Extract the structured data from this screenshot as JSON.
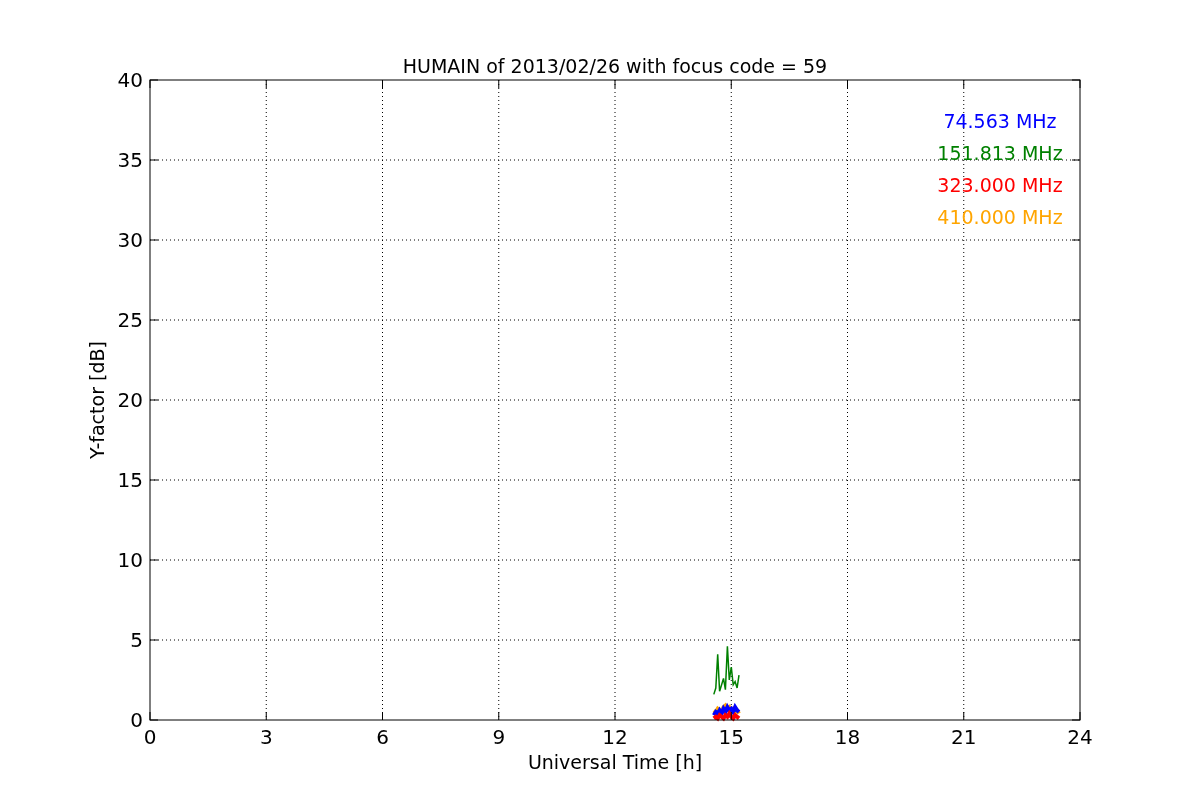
{
  "chart_data": {
    "type": "line",
    "title": "HUMAIN of 2013/02/26 with focus code = 59",
    "xlabel": "Universal Time [h]",
    "ylabel": "Y-factor [dB]",
    "x": [
      14.55,
      14.6,
      14.65,
      14.7,
      14.75,
      14.8,
      14.85,
      14.9,
      14.95,
      15.0,
      15.05,
      15.1,
      15.15,
      15.2
    ],
    "series": [
      {
        "name": "74.563 MHz",
        "color": "#0000ff",
        "values": [
          0.3,
          0.5,
          0.4,
          0.6,
          0.4,
          0.7,
          0.5,
          0.8,
          0.6,
          0.7,
          0.5,
          0.8,
          0.6,
          0.5
        ]
      },
      {
        "name": "151.813 MHz",
        "color": "#008000",
        "values": [
          1.6,
          2.0,
          4.1,
          1.8,
          2.2,
          2.6,
          1.9,
          4.6,
          2.5,
          3.3,
          2.2,
          2.4,
          2.0,
          2.8
        ]
      },
      {
        "name": "323.000 MHz",
        "color": "#ff0000",
        "values": [
          0.1,
          0.2,
          0.1,
          0.3,
          0.2,
          0.1,
          0.3,
          0.2,
          0.4,
          0.2,
          0.1,
          0.3,
          0.2,
          0.1
        ]
      },
      {
        "name": "410.000 MHz",
        "color": "#ffa500",
        "values": [
          0.6,
          0.5,
          0.7,
          0.6,
          0.5,
          0.8,
          0.9,
          0.7,
          0.8,
          0.6,
          0.7,
          0.5,
          0.6,
          0.4
        ]
      }
    ],
    "grid": true,
    "xlim": [
      0,
      24
    ],
    "ylim": [
      0,
      40
    ],
    "xticks": [
      0,
      3,
      6,
      9,
      12,
      15,
      18,
      21,
      24
    ],
    "yticks": [
      0,
      5,
      10,
      15,
      20,
      25,
      30,
      35,
      40
    ]
  }
}
